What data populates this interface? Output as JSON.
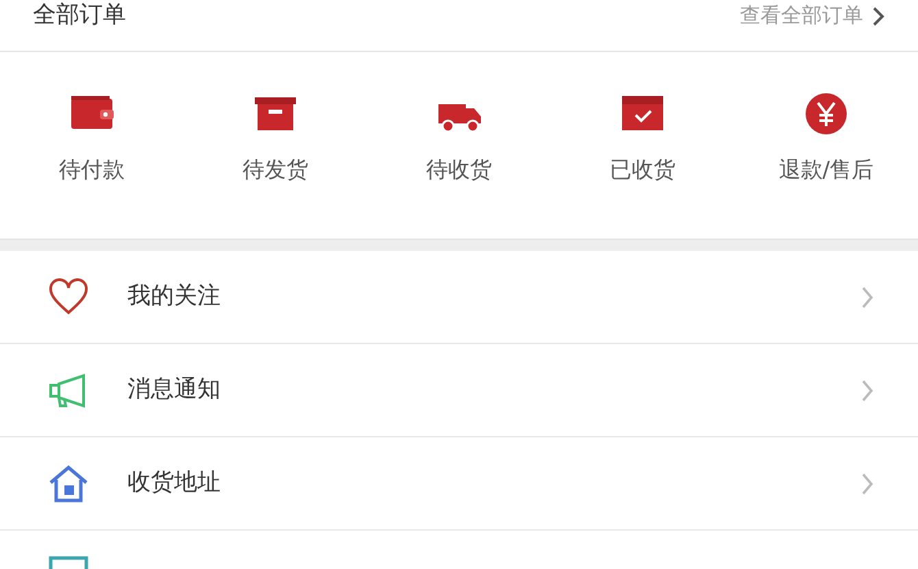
{
  "orders_header": {
    "title": "全部订单",
    "link": "查看全部订单"
  },
  "order_statuses": [
    {
      "label": "待付款"
    },
    {
      "label": "待发货"
    },
    {
      "label": "待收货"
    },
    {
      "label": "已收货"
    },
    {
      "label": "退款/售后"
    }
  ],
  "menu_items": [
    {
      "label": "我的关注"
    },
    {
      "label": "消息通知"
    },
    {
      "label": "收货地址"
    }
  ]
}
